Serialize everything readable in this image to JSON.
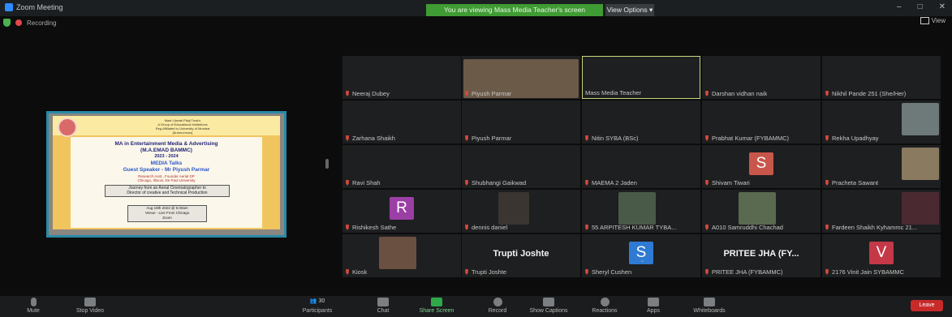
{
  "window": {
    "title": "Zoom Meeting",
    "controls": [
      "–",
      "□",
      "✕"
    ]
  },
  "status": {
    "recording_label": "Recording",
    "view_label": "View"
  },
  "banner": {
    "text": "You are viewing Mass Media Teacher's screen",
    "options": "View Options"
  },
  "share_content": {
    "header_lines": [
      "Mast Lilavati Pilaji Trust's",
      "A Group of Educational Institutions",
      "Reg.Affiliated to University of Mumbai",
      "[Autonomous]"
    ],
    "title": "MA in Entertainment Media & Advertising",
    "title2": "(M.A.EMAD BAMMC)",
    "year": "2023 - 2024",
    "series": "MEDIA Talks",
    "guest": "Guest Speaker - Mr Piyush Parmar",
    "guest_sub1": "Research Asst., Founder Aerial DP",
    "guest_sub2": "Chicago, Illinois, De Paul University",
    "topic1": "Journey from an Aerial Cinematographer to",
    "topic2": "Director of creative and Technical Production",
    "date1": "Aug 19th 2023 @ 9.00am",
    "date2": "Venue - Live From Chicago",
    "date3": "Zoom"
  },
  "participants": [
    {
      "name": "Neeraj Dubey"
    },
    {
      "name": "Piyush Parmar"
    },
    {
      "name": "Mass Media Teacher"
    },
    {
      "name": "Darshan vidhan naik"
    },
    {
      "name": "Nikhil Pande 251 (She/Her)"
    },
    {
      "name": "Zarhana Shaikh"
    },
    {
      "name": "Piyush Parmar"
    },
    {
      "name": "Nitin SYBA (BSc)"
    },
    {
      "name": "Prabhat Kumar (FYBAMMC)"
    },
    {
      "name": "Rekha Upadhyay"
    },
    {
      "name": "Ravi Shah"
    },
    {
      "name": "Shubhangi Gaikwad"
    },
    {
      "name": "MAEMA 2 Jaden"
    },
    {
      "name": "Shivam Tiwari",
      "initial": "S"
    },
    {
      "name": "Pracheta Sawant"
    },
    {
      "name": "Rishikesh Sathe",
      "initial": "R"
    },
    {
      "name": "dennis daniel"
    },
    {
      "name": "55 ARPITESH KUMAR TYBA..."
    },
    {
      "name": "A010 Samruddhi Chachad"
    },
    {
      "name": "Fardeen Shaikh Kyhammc 21..."
    },
    {
      "name": "Kiosk"
    },
    {
      "name": "Trupti Joshte",
      "display": "Trupti Joshte"
    },
    {
      "name": "Sheryl Cushen",
      "initial": "S"
    },
    {
      "name": "PRITEE JHA (FYBAMMC)",
      "display": "PRITEE JHA (FY..."
    },
    {
      "name": "2176 Vinit Jain SYBAMMC",
      "initial": "V"
    }
  ],
  "colors": {
    "banner": "#3f9b33",
    "active_border": "#c7d67a",
    "avatar_R": "#9b3fa5",
    "avatar_S": "#c8564a",
    "avatar_S2": "#2f7ad2",
    "avatar_V": "#c43848",
    "leave": "#c82a2a"
  },
  "toolbar": {
    "mute": "Mute",
    "stop_video": "Stop Video",
    "participants": "Participants",
    "participants_count": "30",
    "chat": "Chat",
    "share_screen": "Share Screen",
    "record": "Record",
    "captions": "Show Captions",
    "reactions": "Reactions",
    "apps": "Apps",
    "whiteboards": "Whiteboards",
    "leave": "Leave"
  }
}
